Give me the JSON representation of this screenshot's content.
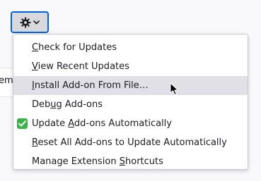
{
  "background_text": "em",
  "gear_button": {
    "icon": "gear-icon",
    "dropdown_icon": "chevron-down-icon"
  },
  "menu": {
    "items": [
      {
        "pre": "",
        "key": "C",
        "post": "heck for Updates",
        "checked": false,
        "hover": false
      },
      {
        "pre": "",
        "key": "V",
        "post": "iew Recent Updates",
        "checked": false,
        "hover": false
      },
      {
        "pre": "",
        "key": "I",
        "post": "nstall Add-on From File…",
        "checked": false,
        "hover": true
      },
      {
        "pre": "Deb",
        "key": "u",
        "post": "g Add-ons",
        "checked": false,
        "hover": false
      },
      {
        "pre": "Update ",
        "key": "A",
        "post": "dd-ons Automatically",
        "checked": true,
        "hover": false
      },
      {
        "pre": "",
        "key": "R",
        "post": "eset All Add-ons to Update Automatically",
        "checked": false,
        "hover": false
      },
      {
        "pre": "Manage Extension ",
        "key": "S",
        "post": "hortcuts",
        "checked": false,
        "hover": false
      }
    ]
  },
  "colors": {
    "button_focus_border": "#0061e0",
    "checkmark_green": "#3cb04a",
    "hover_bg": "#e0e0e6"
  }
}
